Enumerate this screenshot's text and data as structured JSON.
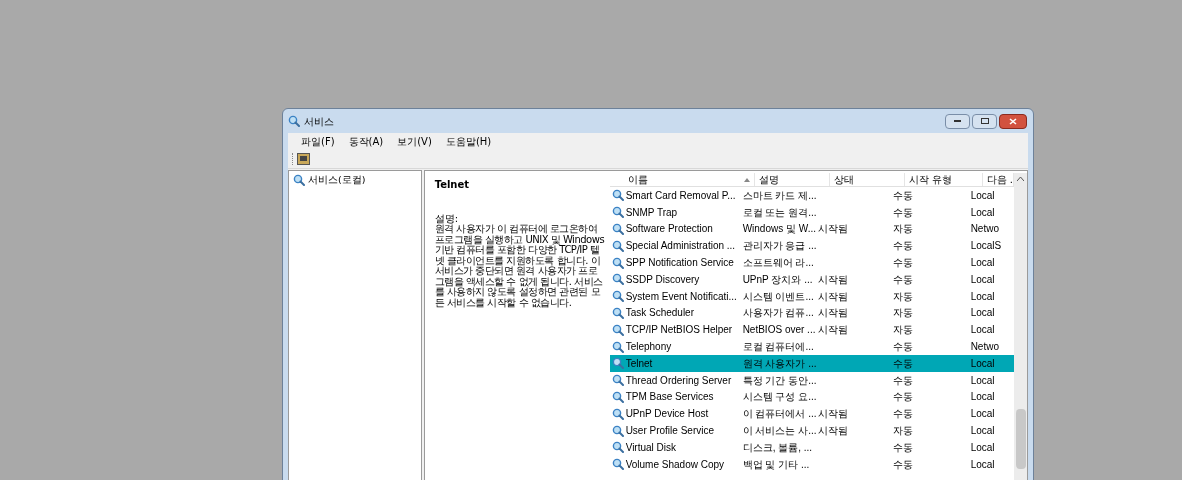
{
  "window": {
    "title": "서비스"
  },
  "menu": [
    "파일(F)",
    "동작(A)",
    "보기(V)",
    "도움말(H)"
  ],
  "tree": {
    "items": [
      {
        "label": "서비스(로컬)",
        "selected": false
      }
    ]
  },
  "detail": {
    "title": "Telnet",
    "description_label": "설명:",
    "description": "원격 사용자가 이 컴퓨터에 로그온하여 프로그램을 실행하고 UNIX 및 Windows 기반 컴퓨터를 포함한 다양한 TCP/IP 텔넷 클라이언트를 지원하도록 합니다. 이 서비스가 중단되면 원격 사용자가 프로그램을 액세스할 수 없게 됩니다. 서비스를 사용하지 않도록 설정하면 관련된 모든 서비스를 시작할 수 없습니다."
  },
  "table": {
    "columns": [
      "이름",
      "설명",
      "상태",
      "시작 유형",
      "다음 ."
    ],
    "rows": [
      {
        "name": "Smart Card Removal P...",
        "description": "스마트 카드 제...",
        "status": "",
        "startup": "수동",
        "logon": "Local",
        "selected": false
      },
      {
        "name": "SNMP Trap",
        "description": "로컬 또는 원격...",
        "status": "",
        "startup": "수동",
        "logon": "Local",
        "selected": false
      },
      {
        "name": "Software Protection",
        "description": "Windows 및 W...",
        "status": "시작됨",
        "startup": "자동",
        "logon": "Netwo",
        "selected": false
      },
      {
        "name": "Special Administration ...",
        "description": "관리자가 응급 ...",
        "status": "",
        "startup": "수동",
        "logon": "LocalS",
        "selected": false
      },
      {
        "name": "SPP Notification Service",
        "description": "소프트웨어 라...",
        "status": "",
        "startup": "수동",
        "logon": "Local",
        "selected": false
      },
      {
        "name": "SSDP Discovery",
        "description": "UPnP 장치와 ...",
        "status": "시작됨",
        "startup": "수동",
        "logon": "Local",
        "selected": false
      },
      {
        "name": "System Event Notificati...",
        "description": "시스템 이벤트...",
        "status": "시작됨",
        "startup": "자동",
        "logon": "Local",
        "selected": false
      },
      {
        "name": "Task Scheduler",
        "description": "사용자가 컴퓨...",
        "status": "시작됨",
        "startup": "자동",
        "logon": "Local",
        "selected": false
      },
      {
        "name": "TCP/IP NetBIOS Helper",
        "description": "NetBIOS over ...",
        "status": "시작됨",
        "startup": "자동",
        "logon": "Local",
        "selected": false
      },
      {
        "name": "Telephony",
        "description": "로컬 컴퓨터에...",
        "status": "",
        "startup": "수동",
        "logon": "Netwo",
        "selected": false
      },
      {
        "name": "Telnet",
        "description": "원격 사용자가 ...",
        "status": "",
        "startup": "수동",
        "logon": "Local",
        "selected": true
      },
      {
        "name": "Thread Ordering Server",
        "description": "특정 기간 동안...",
        "status": "",
        "startup": "수동",
        "logon": "Local",
        "selected": false
      },
      {
        "name": "TPM Base Services",
        "description": "시스템 구성 요...",
        "status": "",
        "startup": "수동",
        "logon": "Local",
        "selected": false
      },
      {
        "name": "UPnP Device Host",
        "description": "이 컴퓨터에서 ...",
        "status": "시작됨",
        "startup": "수동",
        "logon": "Local",
        "selected": false
      },
      {
        "name": "User Profile Service",
        "description": "이 서비스는 사...",
        "status": "시작됨",
        "startup": "자동",
        "logon": "Local",
        "selected": false
      },
      {
        "name": "Virtual Disk",
        "description": "디스크, 볼륨, ...",
        "status": "",
        "startup": "수동",
        "logon": "Local",
        "selected": false
      },
      {
        "name": "Volume Shadow Copy",
        "description": "백업 및 기타 ...",
        "status": "",
        "startup": "수동",
        "logon": "Local",
        "selected": false
      }
    ]
  }
}
